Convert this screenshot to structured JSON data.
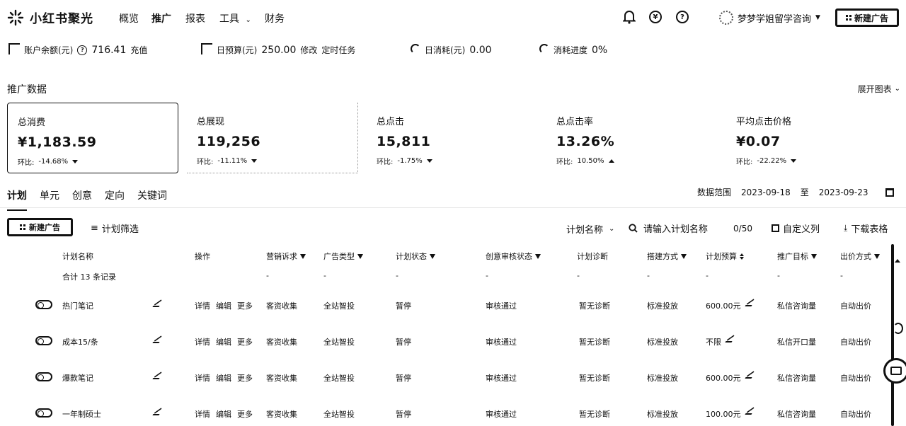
{
  "nav": {
    "brand": "小红书聚光",
    "items": [
      "概览",
      "推广",
      "报表",
      "工具",
      "财务"
    ],
    "user_name": "梦梦学姐留学咨询",
    "new_ad_button": "新建广告",
    "icons": [
      "bell-icon",
      "yen-icon",
      "help-icon"
    ]
  },
  "account": {
    "balance_label": "账户余额(元)",
    "balance_value": "716.41",
    "recharge": "充值",
    "daily_budget_label": "日预算(元)",
    "daily_budget_value": "250.00",
    "modify": "修改",
    "timed_task": "定时任务",
    "daily_spend_label": "日消耗(元)",
    "daily_spend_value": "0.00",
    "spend_progress_label": "消耗进度",
    "spend_progress_value": "0%"
  },
  "promo_data": {
    "title": "推广数据",
    "expand_chart": "展开图表",
    "metrics": [
      {
        "label": "总消费",
        "value": "¥1,183.59",
        "change_label": "环比:",
        "change": "-14.68%",
        "direction": "down"
      },
      {
        "label": "总展现",
        "value": "119,256",
        "change_label": "环比:",
        "change": "-11.11%",
        "direction": "down"
      },
      {
        "label": "总点击",
        "value": "15,811",
        "change_label": "环比:",
        "change": "-1.75%",
        "direction": "down"
      },
      {
        "label": "总点击率",
        "value": "13.26%",
        "change_label": "环比:",
        "change": "10.50%",
        "direction": "up"
      },
      {
        "label": "平均点击价格",
        "value": "¥0.07",
        "change_label": "环比:",
        "change": "-22.22%",
        "direction": "down"
      }
    ]
  },
  "tabs": [
    "计划",
    "单元",
    "创意",
    "定向",
    "关键词"
  ],
  "date_range": {
    "label": "数据范围",
    "start": "2023-09-18",
    "sep": "至",
    "end": "2023-09-23"
  },
  "toolbar": {
    "new_ad": "新建广告",
    "plan_filter": "计划筛选",
    "plan_name_select": "计划名称",
    "search_placeholder": "请输入计划名称",
    "search_count": "0/50",
    "custom_columns": "自定义列",
    "download": "下载表格"
  },
  "table": {
    "columns": [
      "计划名称",
      "操作",
      "营销诉求",
      "广告类型",
      "计划状态",
      "创意审核状态",
      "计划诊断",
      "搭建方式",
      "计划预算",
      "推广目标",
      "出价方式"
    ],
    "summary": {
      "name": "合计 13 条记录",
      "dash": "-"
    },
    "rows": [
      {
        "name": "热门笔记",
        "ops": [
          "详情",
          "编辑",
          "更多"
        ],
        "demand": "客资收集",
        "ad_type": "全站智投",
        "status": "暂停",
        "review": "审核通过",
        "diagnosis": "暂无诊断",
        "build": "标准投放",
        "budget": "600.00元",
        "target": "私信咨询量",
        "bid": "自动出价"
      },
      {
        "name": "成本15/条",
        "ops": [
          "详情",
          "编辑",
          "更多"
        ],
        "demand": "客资收集",
        "ad_type": "全站智投",
        "status": "暂停",
        "review": "审核通过",
        "diagnosis": "暂无诊断",
        "build": "标准投放",
        "budget": "不限",
        "target": "私信开口量",
        "bid": "自动出价"
      },
      {
        "name": "爆款笔记",
        "ops": [
          "详情",
          "编辑",
          "更多"
        ],
        "demand": "客资收集",
        "ad_type": "全站智投",
        "status": "暂停",
        "review": "审核通过",
        "diagnosis": "暂无诊断",
        "build": "标准投放",
        "budget": "600.00元",
        "target": "私信咨询量",
        "bid": "自动出价"
      },
      {
        "name": "一年制硕士",
        "ops": [
          "详情",
          "编辑",
          "更多"
        ],
        "demand": "客资收集",
        "ad_type": "全站智投",
        "status": "暂停",
        "review": "审核通过",
        "diagnosis": "暂无诊断",
        "build": "标准投放",
        "budget": "100.00元",
        "target": "私信咨询量",
        "bid": "自动出价"
      }
    ]
  }
}
